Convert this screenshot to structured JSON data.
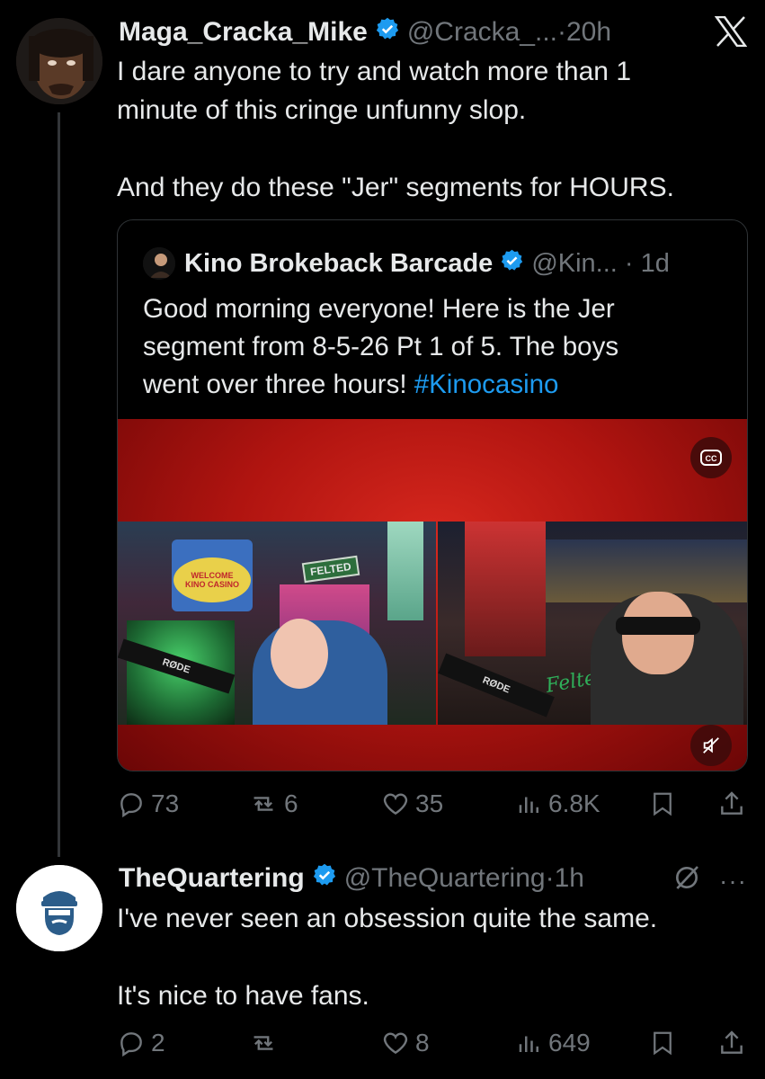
{
  "tweet1": {
    "name": "Maga_Cracka_Mike",
    "handle": "@Cracka_...",
    "time": "20h",
    "text": "I dare anyone to try and watch more than 1\nminute of this cringe unfunny slop.\n\nAnd they do these \"Jer\" segments for HOURS.",
    "quote": {
      "name": "Kino Brokeback Barcade",
      "handle": "@Kin...",
      "time": "1d",
      "text_before": "Good morning everyone! Here is the Jer\nsegment from 8-5-26 Pt 1 of 5. The boys\nwent over three hours! ",
      "hashtag": "#Kinocasino",
      "video_signs": {
        "welcome": "WELCOME",
        "kino_casino": "KINO CASINO",
        "felted": "FELTED",
        "rode_left": "RØDE",
        "rode_right": "RØDE",
        "felted_script": "Felted"
      }
    },
    "stats": {
      "replies": "73",
      "reposts": "6",
      "likes": "35",
      "views": "6.8K"
    }
  },
  "tweet2": {
    "name": "TheQuartering",
    "handle": "@TheQuartering",
    "time": "1h",
    "text": "I've never seen an obsession quite the same.\n\nIt's nice to have fans.",
    "stats": {
      "replies": "2",
      "reposts": "",
      "likes": "8",
      "views": "649"
    }
  },
  "colors": {
    "background": "#000000",
    "text": "#e7e9ea",
    "muted": "#71767b",
    "verified": "#1d9bf0",
    "hashtag": "#1d9bf0",
    "media_red": "#c41a12"
  },
  "icons": [
    "x-logo-icon",
    "verified-badge-icon",
    "reply-icon",
    "repost-icon",
    "like-icon",
    "views-icon",
    "bookmark-icon",
    "share-icon",
    "cc-icon",
    "mute-icon",
    "grok-icon",
    "more-icon"
  ]
}
